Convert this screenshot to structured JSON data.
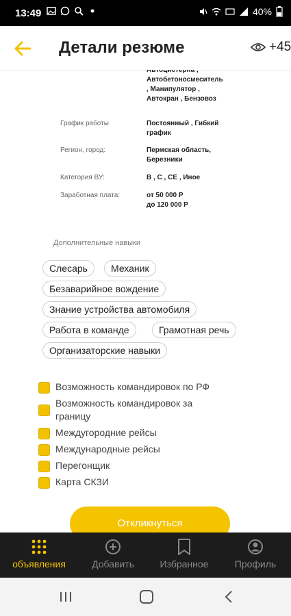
{
  "status_bar": {
    "time": "13:49",
    "battery": "40%"
  },
  "header": {
    "title": "Детали резюме",
    "views_count": "+45"
  },
  "truncated_text": "Автоцистерна ,\nАвтобетоносмеситель\n, Манипулятор ,\nАвтокран , Бензовоз",
  "fields": [
    {
      "label": "График работы",
      "value": "Постоянный , Гибкий\nграфик"
    },
    {
      "label": "Регион, город:",
      "value": "Пермская область,\nБерезники"
    },
    {
      "label": "Категория ВУ:",
      "value": "B , C , CE , Иное"
    },
    {
      "label": "Заработная плата:",
      "value": "от 50 000 Р\nдо 120 000 Р"
    }
  ],
  "skills": {
    "title": "Дополнительные навыки",
    "chips": [
      "Слесарь",
      "Механик",
      "Безаварийное вождение",
      "Знание устройства автомобиля",
      "Работа в команде",
      "Грамотная речь",
      "Организаторские навыки"
    ]
  },
  "checkboxes": [
    {
      "label": "Возможность командировок по РФ",
      "checked": true
    },
    {
      "label": "Возможность командировок за границу",
      "checked": true
    },
    {
      "label": "Междугородние рейсы",
      "checked": true
    },
    {
      "label": "Международные рейсы",
      "checked": true
    },
    {
      "label": "Перегонщик",
      "checked": true
    },
    {
      "label": "Карта СКЗИ",
      "checked": true
    }
  ],
  "respond_button": "Откликнуться",
  "bottom_nav": [
    {
      "label": "объявления",
      "icon": "grid-icon",
      "active": true
    },
    {
      "label": "Добавить",
      "icon": "plus-circle-icon",
      "active": false
    },
    {
      "label": "Избранное",
      "icon": "bookmark-icon",
      "active": false
    },
    {
      "label": "Профиль",
      "icon": "profile-icon",
      "active": false
    }
  ],
  "colors": {
    "accent": "#F2C200",
    "nav_bg": "#1C1C1C",
    "button": "#F5C400"
  }
}
